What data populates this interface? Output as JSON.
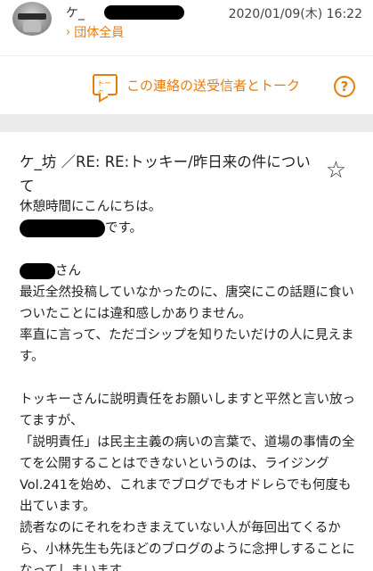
{
  "header": {
    "sender_name": "ケ_",
    "date": "2020/01/09(木) 16:22",
    "group_link": "団体全員"
  },
  "talk": {
    "label": "この連絡の送受信者とトーク",
    "icon_text": "トーク",
    "help_icon": "?"
  },
  "message": {
    "subject": "ケ_坊 ／RE: RE:トッキー/昨日来の件について",
    "star_icon": "☆",
    "lines": [
      "休憩時間にこんにちは。",
      "です。",
      "",
      "さん",
      "最近全然投稿していなかったのに、唐突にこの話題に食いついたことには違和感しかありません。",
      "率直に言って、ただゴシップを知りたいだけの人に見えます。",
      "",
      "トッキーさんに説明責任をお願いしますと平然と言い放ってますが、",
      "「説明責任」は民主主義の病いの言葉で、道場の事情の全てを公開することはできないというのは、ライジングVol.241を始め、これまでブログでもオドレらでも何度も出ています。",
      "読者なのにそれをわきまえていない人が毎回出てくるから、小林先生も先ほどのブログのように念押しすることになってしまいます。"
    ]
  },
  "colors": {
    "accent": "#e87c0a",
    "band": "#ebebeb"
  }
}
